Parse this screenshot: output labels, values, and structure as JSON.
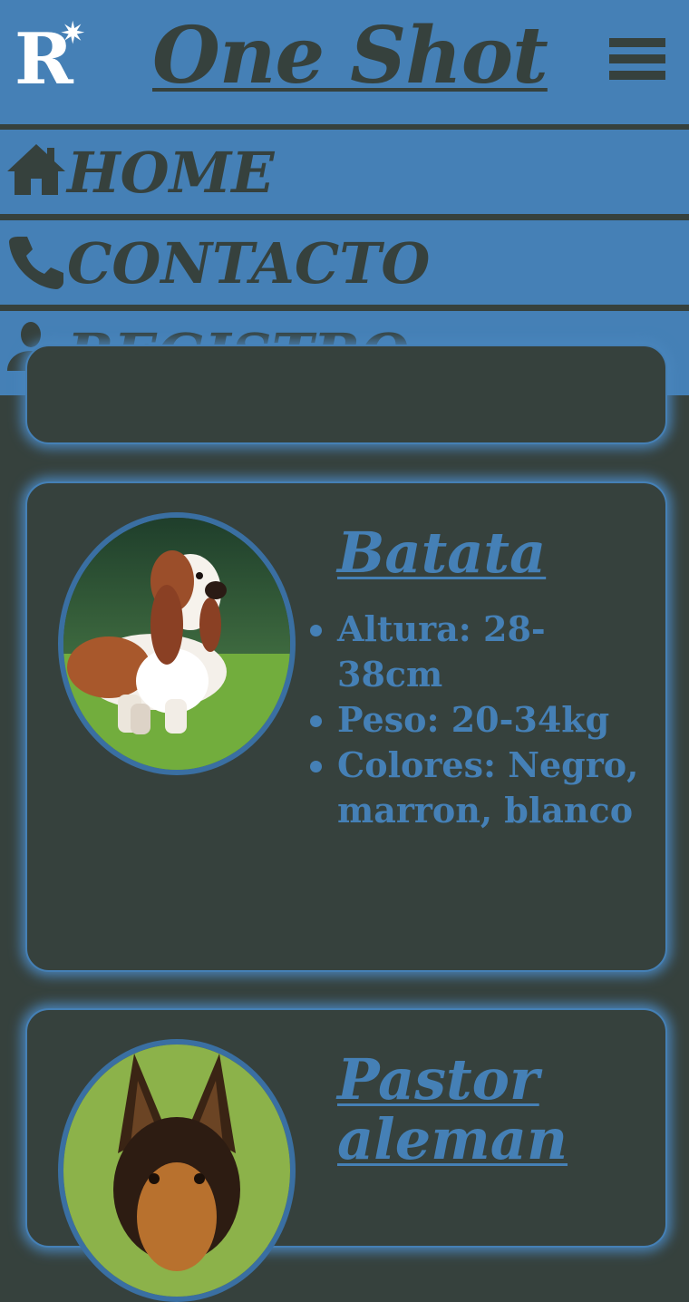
{
  "header": {
    "logo_letter": "R",
    "logo_mark": "✷",
    "brand": "One Shot",
    "menu_icon": "hamburger-menu-icon"
  },
  "nav": [
    {
      "label": "HOME",
      "icon": "home-icon"
    },
    {
      "label": "CONTACTO",
      "icon": "phone-icon"
    },
    {
      "label": "REGISTRO",
      "icon": "add-user-icon"
    }
  ],
  "breeds": [
    {
      "name": "Batata",
      "traits": [
        "Altura: 28-38cm",
        "Peso: 20-34kg",
        "Colores: Negro, marron, blanco"
      ]
    },
    {
      "name": "Pastor aleman"
    }
  ],
  "colors": {
    "primary": "#4580b6",
    "background": "#36413d",
    "logo": "#ffffff"
  }
}
